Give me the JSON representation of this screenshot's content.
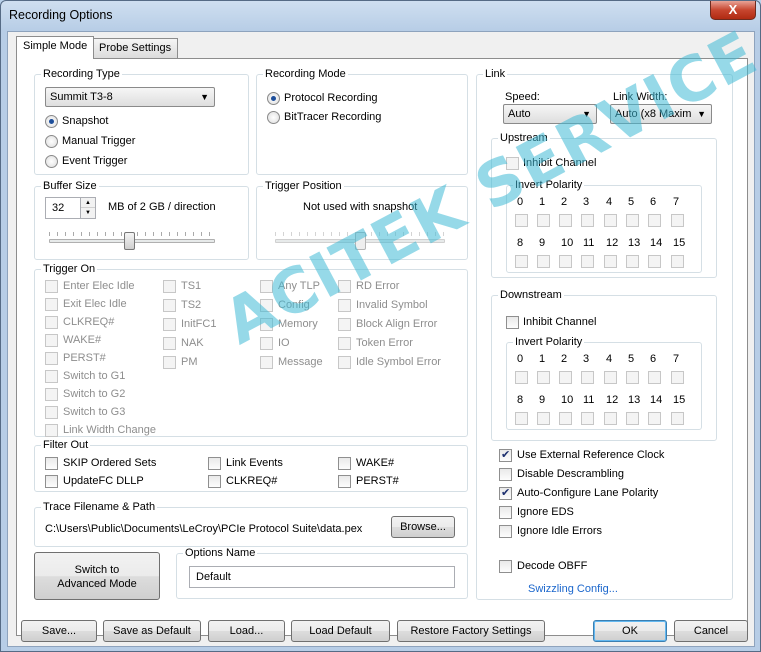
{
  "window": {
    "title": "Recording Options",
    "close_label": "X"
  },
  "tabs": [
    {
      "label": "Simple Mode"
    },
    {
      "label": "Probe Settings"
    }
  ],
  "recording_type": {
    "title": "Recording Type",
    "selected": "Summit T3-8",
    "options": [
      {
        "label": "Snapshot",
        "checked": true
      },
      {
        "label": "Manual Trigger",
        "checked": false
      },
      {
        "label": "Event Trigger",
        "checked": false
      }
    ]
  },
  "recording_mode": {
    "title": "Recording Mode",
    "options": [
      {
        "label": "Protocol Recording",
        "checked": true
      },
      {
        "label": "BitTracer Recording",
        "checked": false
      }
    ]
  },
  "buffer_size": {
    "title": "Buffer Size",
    "value": "32",
    "unit_text": "MB of 2 GB / direction",
    "slider_level": 0.48
  },
  "trigger_position": {
    "title": "Trigger Position",
    "note": "Not used with snapshot",
    "slider_level": 0.5
  },
  "trigger_on": {
    "title": "Trigger On",
    "col1": [
      "Enter Elec Idle",
      "Exit Elec Idle",
      "CLKREQ#",
      "WAKE#",
      "PERST#",
      "Switch to G1",
      "Switch to G2",
      "Switch to G3",
      "Link Width Change"
    ],
    "col2": [
      "TS1",
      "TS2",
      "InitFC1",
      "NAK",
      "PM"
    ],
    "col3": [
      "Any TLP",
      "Config",
      "Memory",
      "IO",
      "Message"
    ],
    "col4": [
      "RD Error",
      "Invalid Symbol",
      "Block Align Error",
      "Token Error",
      "Idle Symbol Error"
    ]
  },
  "filter_out": {
    "title": "Filter Out",
    "items": [
      {
        "label": "SKIP Ordered Sets",
        "checked": false
      },
      {
        "label": "Link Events",
        "checked": false
      },
      {
        "label": "WAKE#",
        "checked": false
      },
      {
        "label": "UpdateFC DLLP",
        "checked": false
      },
      {
        "label": "CLKREQ#",
        "checked": false
      },
      {
        "label": "PERST#",
        "checked": false
      }
    ]
  },
  "trace": {
    "title": "Trace Filename & Path",
    "path": "C:\\Users\\Public\\Documents\\LeCroy\\PCIe Protocol Suite\\data.pex",
    "browse_label": "Browse..."
  },
  "switch_button": {
    "line1": "Switch to",
    "line2": "Advanced Mode"
  },
  "options_name": {
    "title": "Options Name",
    "value": "Default"
  },
  "link": {
    "title": "Link",
    "speed_label": "Speed:",
    "speed_value": "Auto",
    "width_label": "Link Width:",
    "width_value": "Auto (x8 Maxim",
    "upstream": {
      "title": "Upstream",
      "inhibit_label": "Inhibit Channel",
      "invert_label": "Invert Polarity"
    },
    "downstream": {
      "title": "Downstream",
      "inhibit_label": "Inhibit Channel",
      "invert_label": "Invert Polarity"
    },
    "lanes_row1": [
      "0",
      "1",
      "2",
      "3",
      "4",
      "5",
      "6",
      "7"
    ],
    "lanes_row2": [
      "8",
      "9",
      "10",
      "11",
      "12",
      "13",
      "14",
      "15"
    ]
  },
  "extra_options": [
    {
      "label": "Use External Reference Clock",
      "checked": true
    },
    {
      "label": "Disable Descrambling",
      "checked": false
    },
    {
      "label": "Auto-Configure Lane Polarity",
      "checked": true
    },
    {
      "label": "Ignore EDS",
      "checked": false
    },
    {
      "label": "Ignore Idle Errors",
      "checked": false
    }
  ],
  "decode_obff": {
    "label": "Decode OBFF",
    "checked": false
  },
  "swizzling_link": "Swizzling Config...",
  "bottom_buttons": {
    "save": "Save...",
    "save_default": "Save as Default",
    "load": "Load...",
    "load_default": "Load Default",
    "restore": "Restore Factory Settings",
    "ok": "OK",
    "cancel": "Cancel"
  },
  "watermark": "ACITEK SERVICE"
}
